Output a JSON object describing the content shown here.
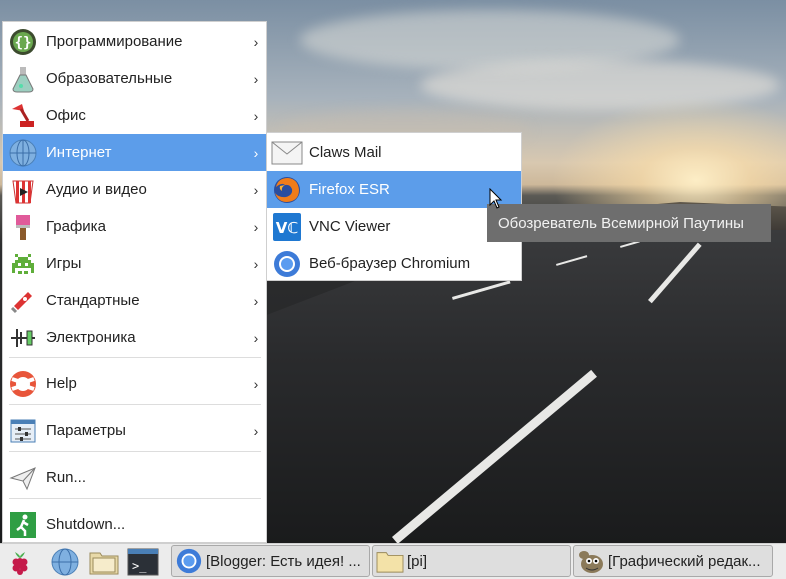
{
  "menu": {
    "items": [
      {
        "label": "Программирование",
        "icon": "programming-icon",
        "has_submenu": true
      },
      {
        "label": "Образовательные",
        "icon": "education-icon",
        "has_submenu": true
      },
      {
        "label": "Офис",
        "icon": "office-icon",
        "has_submenu": true
      },
      {
        "label": "Интернет",
        "icon": "internet-icon",
        "has_submenu": true,
        "active": true
      },
      {
        "label": "Аудио и видео",
        "icon": "audio-video-icon",
        "has_submenu": true
      },
      {
        "label": "Графика",
        "icon": "graphics-icon",
        "has_submenu": true
      },
      {
        "label": "Игры",
        "icon": "games-icon",
        "has_submenu": true
      },
      {
        "label": "Стандартные",
        "icon": "accessories-icon",
        "has_submenu": true
      },
      {
        "label": "Электроника",
        "icon": "electronics-icon",
        "has_submenu": true
      },
      {
        "label": "Help",
        "icon": "help-icon",
        "has_submenu": true
      },
      {
        "label": "Параметры",
        "icon": "preferences-icon",
        "has_submenu": true
      },
      {
        "label": "Run...",
        "icon": "run-icon",
        "has_submenu": false
      },
      {
        "label": "Shutdown...",
        "icon": "shutdown-icon",
        "has_submenu": false
      }
    ],
    "arrow": "›"
  },
  "submenu": {
    "items": [
      {
        "label": "Claws Mail",
        "icon": "mail-icon"
      },
      {
        "label": "Firefox ESR",
        "icon": "firefox-icon",
        "active": true
      },
      {
        "label": "VNC Viewer",
        "icon": "vnc-icon"
      },
      {
        "label": "Веб-браузер Chromium",
        "icon": "chromium-icon"
      }
    ]
  },
  "tooltip": {
    "text": "Обозреватель Всемирной Паутины"
  },
  "taskbar": {
    "launchers": [
      "raspberry-menu-icon",
      "web-browser-icon",
      "file-manager-icon",
      "terminal-icon"
    ],
    "tasks": [
      {
        "label": "[Blogger: Есть идея! ...",
        "icon": "chromium-icon"
      },
      {
        "label": "[pi]",
        "icon": "folder-icon"
      },
      {
        "label": "[Графический редак...",
        "icon": "gimp-icon"
      }
    ]
  },
  "colors": {
    "highlight": "#5c9dea",
    "tooltip_bg": "#6e6e6e",
    "panel": "#ececec"
  }
}
